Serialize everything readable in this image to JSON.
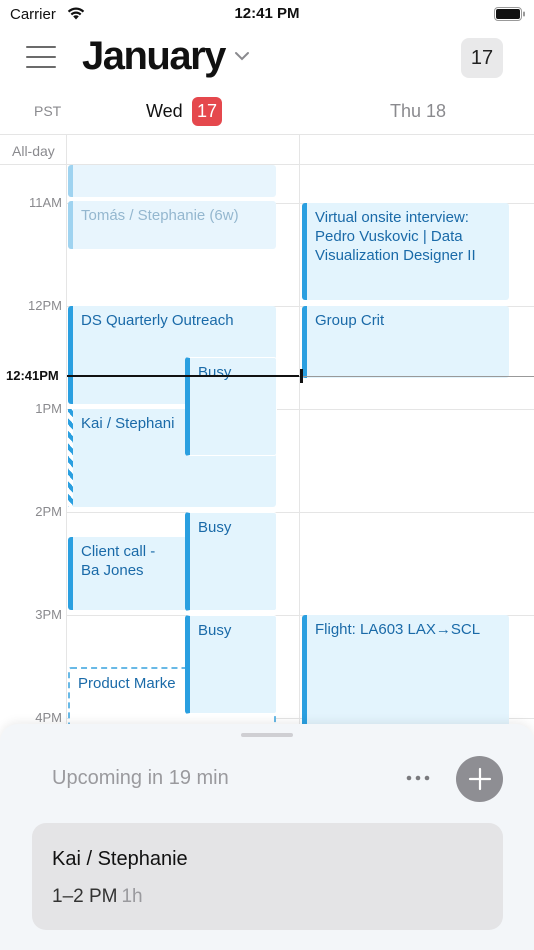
{
  "status_bar": {
    "carrier": "Carrier",
    "time": "12:41 PM"
  },
  "header": {
    "month": "January",
    "today_day": "17"
  },
  "days": {
    "timezone": "PST",
    "wed_label": "Wed",
    "wed_number": "17",
    "thu_label": "Thu 18"
  },
  "allday_label": "All-day",
  "hours": {
    "h11": "11AM",
    "h12": "12PM",
    "h13": "1PM",
    "h14": "2PM",
    "h15": "3PM",
    "h16": "4PM"
  },
  "now": {
    "label": "12:41PM"
  },
  "events": {
    "tomas": "Tomás / Stephanie (6w)",
    "ds_quarterly": "DS Quarterly Outreach",
    "busy_1": "Busy",
    "kai": "Kai / Stephani",
    "client_call": "Client call - Ba Jones",
    "busy_2": "Busy",
    "busy_3": "Busy",
    "product_marke": "Product Marke",
    "virtual_onsite": "Virtual onsite interview: Pedro Vuskovic | Data Visualization Designer II",
    "group_crit": "Group Crit",
    "flight": "Flight: LA603 LAX→SCL"
  },
  "sheet": {
    "upcoming": "Upcoming in 19 min",
    "card_title": "Kai / Stephanie",
    "card_time": "1–2 PM",
    "card_duration": "1h"
  },
  "colors": {
    "accent": "#2a9fe0",
    "event_bg": "#e3f4fd",
    "event_text": "#1a6aa8",
    "today_badge": "#e5484d"
  }
}
